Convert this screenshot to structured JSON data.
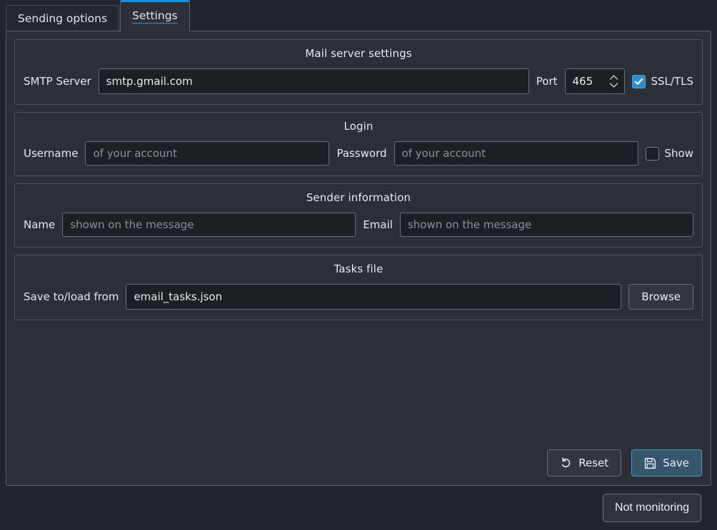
{
  "tabs": [
    {
      "label": "Sending options",
      "active": false
    },
    {
      "label": "Settings",
      "active": true
    }
  ],
  "sections": {
    "mail_server": {
      "title": "Mail server settings",
      "smtp_label": "SMTP Server",
      "smtp_value": "smtp.gmail.com",
      "port_label": "Port",
      "port_value": "465",
      "ssl_label": "SSL/TLS",
      "ssl_checked": true
    },
    "login": {
      "title": "Login",
      "username_label": "Username",
      "username_value": "",
      "username_placeholder": "of your account",
      "password_label": "Password",
      "password_value": "",
      "password_placeholder": "of your account",
      "show_label": "Show",
      "show_checked": false
    },
    "sender": {
      "title": "Sender information",
      "name_label": "Name",
      "name_value": "",
      "name_placeholder": "shown on the message",
      "email_label": "Email",
      "email_value": "",
      "email_placeholder": "shown on the message"
    },
    "tasks_file": {
      "title": "Tasks file",
      "path_label": "Save to/load from",
      "path_value": "email_tasks.json",
      "browse_label": "Browse"
    }
  },
  "actions": {
    "reset_label": "Reset",
    "reset_icon": "undo-arrow-icon",
    "save_label": "Save",
    "save_icon": "floppy-disk-icon"
  },
  "statusbar": {
    "monitor_label": "Not monitoring"
  },
  "colors": {
    "window_bg": "#22262c",
    "panel_bg": "#2b2f36",
    "input_bg": "#1c2025",
    "accent": "#1e90cf",
    "checkbox_on": "#2e8ccd",
    "primary_button_bg": "#35566b",
    "primary_button_border": "#4e96c0",
    "placeholder_text": "#8c9197"
  }
}
